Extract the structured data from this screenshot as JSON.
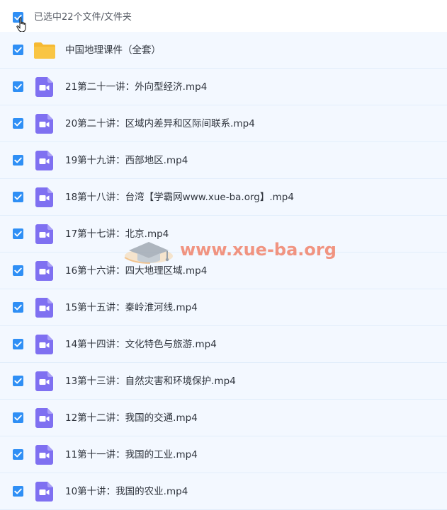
{
  "header": {
    "selected_text": "已选中22个文件/文件夹",
    "checked": true
  },
  "colors": {
    "checkbox": "#2f8ff5",
    "row_background": "#f3f8ff",
    "row_border": "#e2eefb",
    "folder": "#f9c544",
    "video_icon": "#7f70f1",
    "watermark": "#f06e50"
  },
  "items": [
    {
      "type": "folder",
      "icon": "folder-icon",
      "name": "中国地理课件（全套）",
      "checked": true
    },
    {
      "type": "video",
      "icon": "video-file-icon",
      "name": "21第二十一讲：外向型经济.mp4",
      "checked": true
    },
    {
      "type": "video",
      "icon": "video-file-icon",
      "name": "20第二十讲：区域内差异和区际间联系.mp4",
      "checked": true
    },
    {
      "type": "video",
      "icon": "video-file-icon",
      "name": "19第十九讲：西部地区.mp4",
      "checked": true
    },
    {
      "type": "video",
      "icon": "video-file-icon",
      "name": "18第十八讲：台湾【学霸网www.xue-ba.org】.mp4",
      "checked": true
    },
    {
      "type": "video",
      "icon": "video-file-icon",
      "name": "17第十七讲：北京.mp4",
      "checked": true
    },
    {
      "type": "video",
      "icon": "video-file-icon",
      "name": "16第十六讲：四大地理区域.mp4",
      "checked": true
    },
    {
      "type": "video",
      "icon": "video-file-icon",
      "name": "15第十五讲：秦岭淮河线.mp4",
      "checked": true
    },
    {
      "type": "video",
      "icon": "video-file-icon",
      "name": "14第十四讲：文化特色与旅游.mp4",
      "checked": true
    },
    {
      "type": "video",
      "icon": "video-file-icon",
      "name": "13第十三讲：自然灾害和环境保护.mp4",
      "checked": true
    },
    {
      "type": "video",
      "icon": "video-file-icon",
      "name": "12第十二讲：我国的交通.mp4",
      "checked": true
    },
    {
      "type": "video",
      "icon": "video-file-icon",
      "name": "11第十一讲：我国的工业.mp4",
      "checked": true
    },
    {
      "type": "video",
      "icon": "video-file-icon",
      "name": "10第十讲：我国的农业.mp4",
      "checked": true
    }
  ],
  "watermark": {
    "text": "www.xue-ba.org"
  }
}
